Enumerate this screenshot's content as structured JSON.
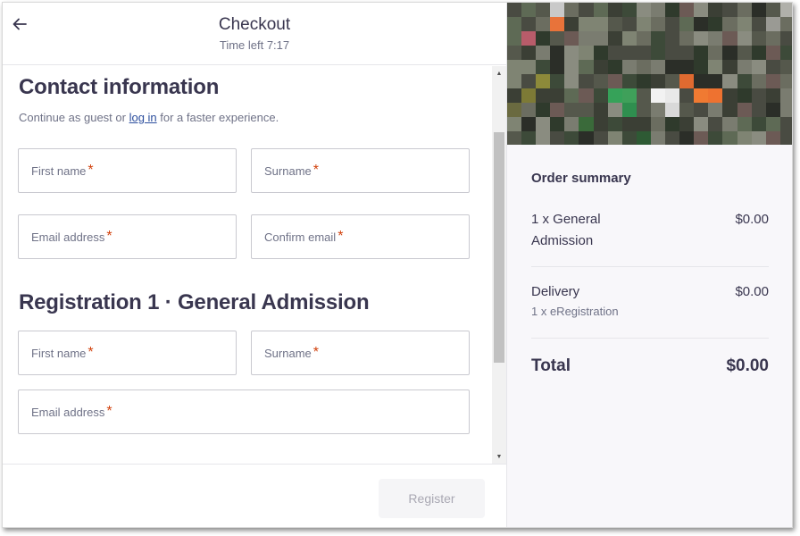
{
  "header": {
    "title": "Checkout",
    "timer": "Time left 7:17",
    "back_icon": "arrow-left-icon"
  },
  "contact": {
    "title": "Contact information",
    "hint_before": "Continue as guest or ",
    "hint_link": "log in",
    "hint_after": " for a faster experience.",
    "first_name": "First name",
    "surname": "Surname",
    "email": "Email address",
    "confirm_email": "Confirm email",
    "required_marker": "*"
  },
  "registration": {
    "title": "Registration 1 · General Admission",
    "first_name": "First name",
    "surname": "Surname",
    "email": "Email address"
  },
  "footer": {
    "register_label": "Register"
  },
  "summary": {
    "title": "Order summary",
    "items": [
      {
        "name": "1 x General Admission",
        "price": "$0.00",
        "sub": ""
      },
      {
        "name": "Delivery",
        "price": "$0.00",
        "sub": "1 x eRegistration"
      }
    ],
    "total_label": "Total",
    "total_value": "$0.00"
  },
  "colors": {
    "accent_required": "#d1410c",
    "text_primary": "#39364f",
    "text_secondary": "#6f7287",
    "summary_bg": "#f8f7fa"
  }
}
